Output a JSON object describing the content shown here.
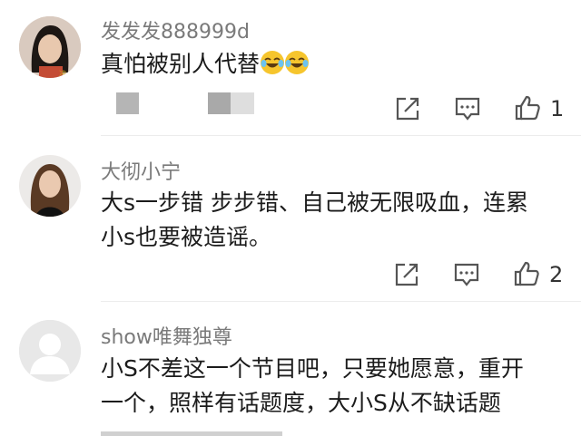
{
  "comments": [
    {
      "username": "发发发888999d",
      "lines": [
        "真怕被别人代替"
      ],
      "emoji": [
        "laugh-cry-emoji",
        "laugh-cry-emoji"
      ],
      "like_count": "1"
    },
    {
      "username": "大彻小宁",
      "lines": [
        "大s一步错 步步错、自己被无限吸血，连累",
        "小s也要被造谣。"
      ],
      "like_count": "2"
    },
    {
      "username": "show唯舞独尊",
      "lines": [
        "小S不差这一个节目吧，只要她愿意，重开",
        "一个，照样有话题度，大小S从不缺话题"
      ],
      "like_count": ""
    }
  ],
  "icons": {
    "share": "share-icon",
    "comment": "comment-icon",
    "like": "thumbs-up-icon"
  },
  "colors": {
    "username": "#7a7a7a",
    "text": "#1b1b1b",
    "icon": "#555555",
    "emoji": "#f6c52d"
  }
}
